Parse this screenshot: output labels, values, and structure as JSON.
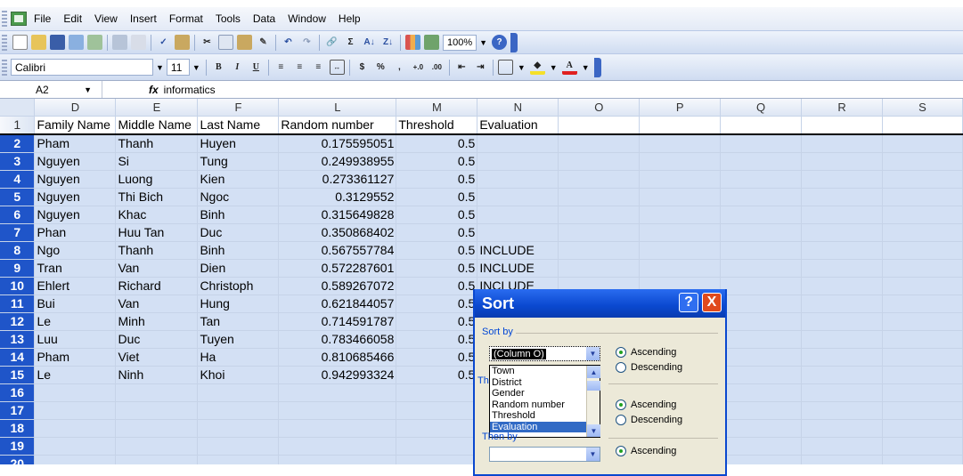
{
  "menu": [
    "File",
    "Edit",
    "View",
    "Insert",
    "Format",
    "Tools",
    "Data",
    "Window",
    "Help"
  ],
  "toolbar": {
    "zoom": "100%",
    "font": "Calibri",
    "size": "11",
    "bold": "B",
    "italic": "I",
    "underline": "U",
    "currency": "$",
    "percent": "%",
    "comma": ","
  },
  "formula_bar": {
    "cell": "A2",
    "fx": "fx",
    "content": "informatics"
  },
  "columns": [
    "D",
    "E",
    "F",
    "L",
    "M",
    "N",
    "O",
    "P",
    "Q",
    "R",
    "S"
  ],
  "rows": [
    {
      "n": "1",
      "cells": [
        "Family Name",
        "Middle Name",
        "Last Name",
        "Random number",
        "Threshold",
        "Evaluation"
      ]
    },
    {
      "n": "2",
      "cells": [
        "Pham",
        "Thanh",
        "Huyen",
        "0.175595051",
        "0.5",
        ""
      ]
    },
    {
      "n": "3",
      "cells": [
        "Nguyen",
        "Si",
        "Tung",
        "0.249938955",
        "0.5",
        ""
      ]
    },
    {
      "n": "4",
      "cells": [
        "Nguyen",
        "Luong",
        "Kien",
        "0.273361127",
        "0.5",
        ""
      ]
    },
    {
      "n": "5",
      "cells": [
        "Nguyen",
        "Thi Bich",
        "Ngoc",
        "0.3129552",
        "0.5",
        ""
      ]
    },
    {
      "n": "6",
      "cells": [
        "Nguyen",
        "Khac",
        "Binh",
        "0.315649828",
        "0.5",
        ""
      ]
    },
    {
      "n": "7",
      "cells": [
        "Phan",
        "Huu Tan",
        "Duc",
        "0.350868402",
        "0.5",
        ""
      ]
    },
    {
      "n": "8",
      "cells": [
        "Ngo",
        "Thanh",
        "Binh",
        "0.567557784",
        "0.5",
        "INCLUDE"
      ]
    },
    {
      "n": "9",
      "cells": [
        "Tran",
        "Van",
        "Dien",
        "0.572287601",
        "0.5",
        "INCLUDE"
      ]
    },
    {
      "n": "10",
      "cells": [
        "Ehlert",
        "Richard",
        "Christoph",
        "0.589267072",
        "0.5",
        "INCLUDE"
      ]
    },
    {
      "n": "11",
      "cells": [
        "Bui",
        "Van",
        "Hung",
        "0.621844057",
        "0.5",
        ""
      ]
    },
    {
      "n": "12",
      "cells": [
        "Le",
        "Minh",
        "Tan",
        "0.714591787",
        "0.5",
        ""
      ]
    },
    {
      "n": "13",
      "cells": [
        "Luu",
        "Duc",
        "Tuyen",
        "0.783466058",
        "0.5",
        ""
      ]
    },
    {
      "n": "14",
      "cells": [
        "Pham",
        "Viet",
        "Ha",
        "0.810685466",
        "0.5",
        ""
      ]
    },
    {
      "n": "15",
      "cells": [
        "Le",
        "Ninh",
        "Khoi",
        "0.942993324",
        "0.5",
        ""
      ]
    },
    {
      "n": "16",
      "cells": [
        "",
        "",
        "",
        "",
        "",
        ""
      ]
    },
    {
      "n": "17",
      "cells": [
        "",
        "",
        "",
        "",
        "",
        ""
      ]
    },
    {
      "n": "18",
      "cells": [
        "",
        "",
        "",
        "",
        "",
        ""
      ]
    },
    {
      "n": "19",
      "cells": [
        "",
        "",
        "",
        "",
        "",
        ""
      ]
    },
    {
      "n": "20",
      "cells": [
        "",
        "",
        "",
        "",
        "",
        ""
      ]
    }
  ],
  "dialog": {
    "title": "Sort",
    "help": "?",
    "close": "X",
    "sort_by_label": "Sort by",
    "then_by_label": "Then by",
    "then_by_partial": "Th",
    "sort_by_value": "(Column O)",
    "list_items": [
      "Town",
      "District",
      "Gender",
      "Random number",
      "Threshold",
      "Evaluation"
    ],
    "ascending": "Ascending",
    "descending": "Descending"
  }
}
